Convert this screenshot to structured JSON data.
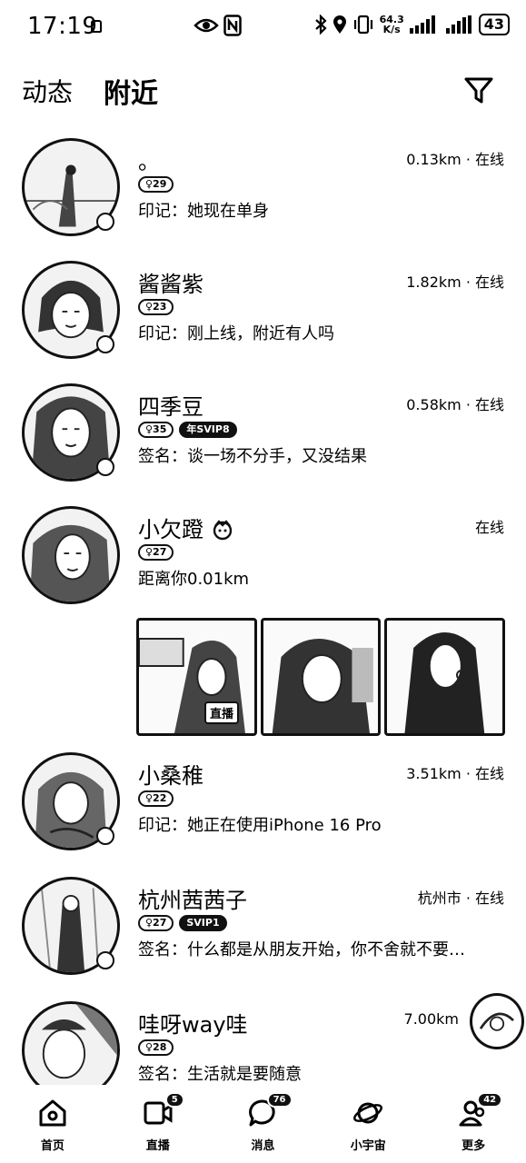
{
  "status_bar": {
    "time": "17:19",
    "net_speed_value": "64.3",
    "net_speed_unit": "K/s",
    "battery": "43"
  },
  "header": {
    "tab_dynamic": "动态",
    "tab_nearby": "附近",
    "filter_icon": "filter-icon"
  },
  "users": [
    {
      "name": "。",
      "meta": "0.13km · 在线",
      "badges": [
        "♀29"
      ],
      "sub": "印记：她现在单身",
      "online": true
    },
    {
      "name": "酱酱紫",
      "meta": "1.82km · 在线",
      "badges": [
        "♀23"
      ],
      "sub": "印记：刚上线，附近有人吗",
      "online": true
    },
    {
      "name": "四季豆",
      "meta": "0.58km · 在线",
      "badges": [
        "♀35",
        "年SVIP8"
      ],
      "sub": "签名：谈一场不分手，又没结果",
      "online": true
    },
    {
      "name": "小欠蹬",
      "meta": "在线",
      "badges": [
        "♀27"
      ],
      "sub": "距离你0.01km",
      "online": false
    },
    {
      "name": "小桑稚",
      "meta": "3.51km · 在线",
      "badges": [
        "♀22"
      ],
      "sub": "印记：她正在使用iPhone 16 Pro",
      "online": true
    },
    {
      "name": "杭州茜茜子",
      "meta": "杭州市 · 在线",
      "badges": [
        "♀27",
        "SVIP1"
      ],
      "sub": "签名：什么都是从朋友开始，你不舍就不要…",
      "online": true
    },
    {
      "name": "哇呀way哇",
      "meta": "7.00km",
      "badges": [
        "♀28"
      ],
      "sub": "签名：生活就是要随意",
      "online": false
    }
  ],
  "photo_strip": {
    "live_label": "直播"
  },
  "bottom_nav": [
    {
      "label": "首页",
      "icon": "home-icon",
      "badge": ""
    },
    {
      "label": "直播",
      "icon": "live-camera-icon",
      "badge": "5"
    },
    {
      "label": "消息",
      "icon": "message-bubble-icon",
      "badge": "76"
    },
    {
      "label": "小宇宙",
      "icon": "planet-icon",
      "badge": ""
    },
    {
      "label": "更多",
      "icon": "people-icon",
      "badge": "42"
    }
  ]
}
